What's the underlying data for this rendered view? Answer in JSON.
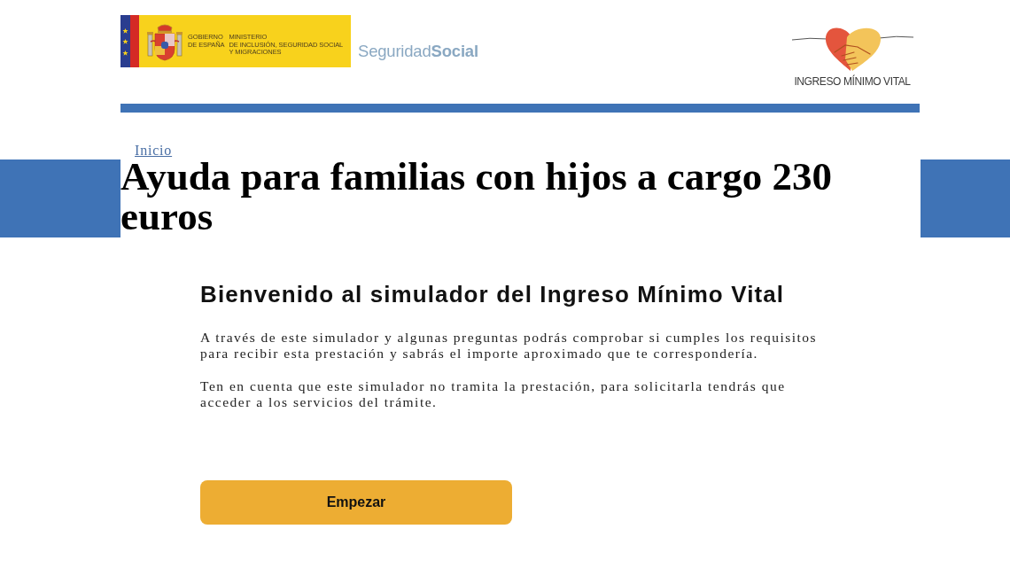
{
  "header": {
    "government_logo": {
      "name_lines": [
        "GOBIERNO",
        "DE ESPAÑA"
      ],
      "ministry_lines": [
        "MINISTERIO",
        "DE INCLUSIÓN, SEGURIDAD SOCIAL",
        "Y MIGRACIONES"
      ]
    },
    "social_security_logo": "Seguridad**Social**",
    "program_logo": "INGRESO MÍNIMO VITAL"
  },
  "breadcrumb": [
    {
      "label": "Inicio"
    }
  ],
  "page_title": "Ayuda para familias con hijos a cargo 230 euros",
  "simulator": {
    "heading": "Bienvenido al simulador del Ingreso Mínimo Vital",
    "paragraphs": [
      "A través de este simulador y algunas preguntas podrás comprobar si cumples los requisitos para recibir esta prestación y sabrás el importe aproximado que te correspondería.",
      "Ten en cuenta que este simulador no tramita la prestación, para solicitarla tendrás que acceder a los servicios del trámite."
    ],
    "start_button": "Empezar"
  }
}
